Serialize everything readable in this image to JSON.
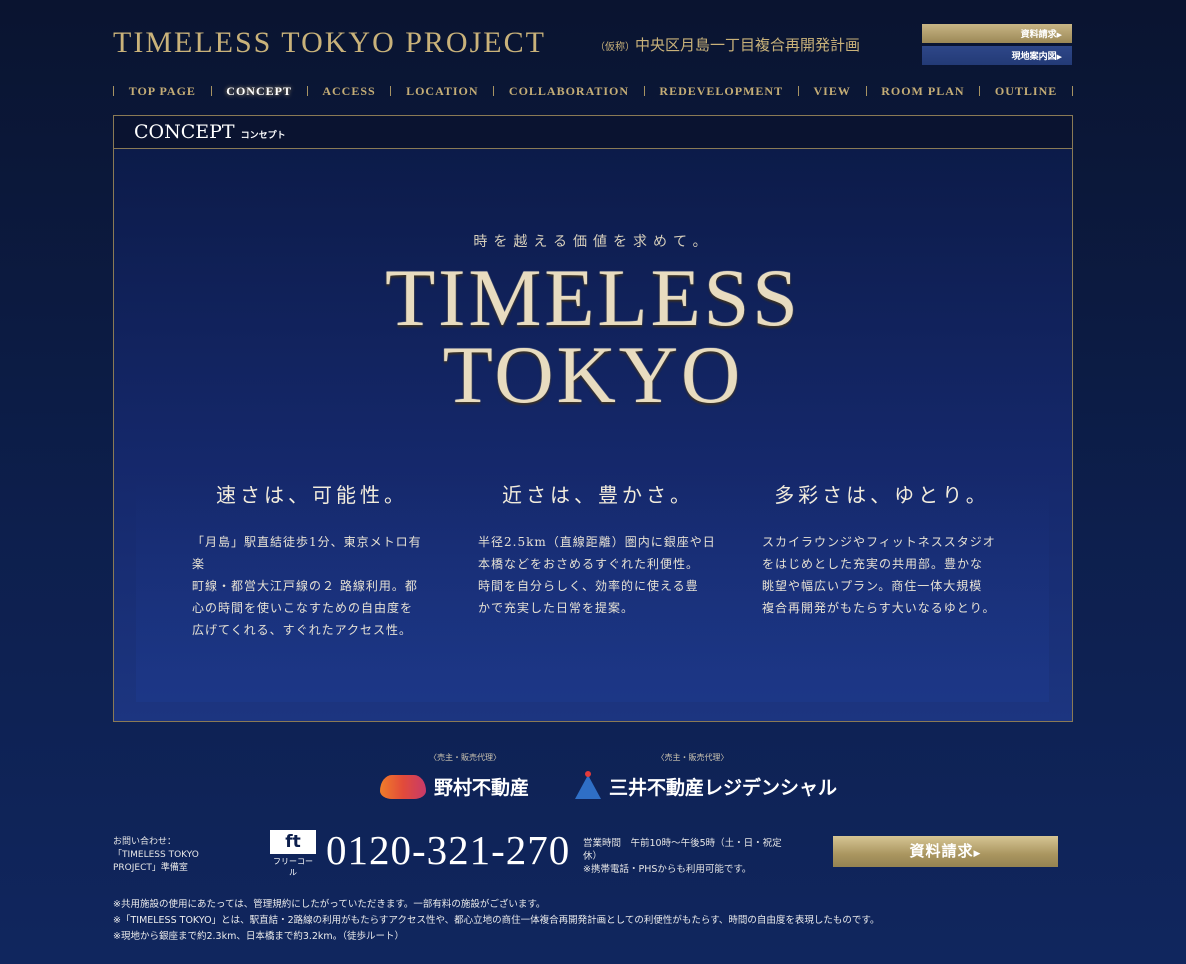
{
  "header": {
    "logo": "TIMELESS TOKYO PROJECT",
    "subtitle_prefix": "（仮称）",
    "subtitle": "中央区月島一丁目複合再開発計画",
    "buttons": [
      {
        "label": "資料請求",
        "arrow": "▶"
      },
      {
        "label": "現地案内図",
        "arrow": "▶"
      }
    ],
    "colors": {
      "gold": "#c9b27a",
      "navy_button": "#2e4788"
    }
  },
  "nav": {
    "items": [
      {
        "label": "TOP PAGE"
      },
      {
        "label": "CONCEPT",
        "active": true
      },
      {
        "label": "ACCESS"
      },
      {
        "label": "LOCATION"
      },
      {
        "label": "COLLABORATION"
      },
      {
        "label": "REDEVELOPMENT"
      },
      {
        "label": "VIEW"
      },
      {
        "label": "ROOM PLAN"
      },
      {
        "label": "OUTLINE"
      }
    ]
  },
  "panel": {
    "title": "CONCEPT",
    "title_sub": "コンセプト"
  },
  "hero": {
    "tagline": "時を越える価値を求めて。",
    "title_line1": "TIMELESS",
    "title_line2": "TOKYO",
    "columns": [
      {
        "heading": "速さは、可能性。",
        "lines": [
          "「月島」駅直結徒歩1分、東京メトロ有楽",
          "町線・都営大江戸線の２ 路線利用。都",
          "心の時間を使いこなすための自由度を",
          "広げてくれる、すぐれたアクセス性。"
        ]
      },
      {
        "heading": "近さは、豊かさ。",
        "lines": [
          "半径2.5km（直線距離）圏内に銀座や日",
          "本橋などをおさめるすぐれた利便性。",
          "時間を自分らしく、効率的に使える豊",
          "かで充実した日常を提案。"
        ]
      },
      {
        "heading": "多彩さは、ゆとり。",
        "lines": [
          "スカイラウンジやフィットネススタジオ",
          "をはじめとした充実の共用部。豊かな",
          "眺望や幅広いプラン。商住一体大規模",
          "複合再開発がもたらす大いなるゆとり。"
        ]
      }
    ]
  },
  "partners": [
    {
      "role": "〈売主・販売代理〉",
      "name": "野村不動産",
      "icon": "nomura-logo-icon"
    },
    {
      "role": "〈売主・販売代理〉",
      "name": "三井不動産レジデンシャル",
      "icon": "mitsui-logo-icon"
    }
  ],
  "contact": {
    "label_lines": [
      "お問い合わせ：",
      "「TIMELESS TOKYO",
      "PROJECT」準備室"
    ],
    "freecall_mark": "ft",
    "freecall_text": "フリーコール",
    "phone": "0120-321-270",
    "hours_lines": [
      "営業時間　午前10時〜午後5時（土・日・祝定",
      "休）",
      "※携帯電話・PHSからも利用可能です。"
    ],
    "request_button": "資料請求",
    "request_arrow": "▶"
  },
  "notes": [
    "※共用施設の使用にあたっては、管理規約にしたがっていただきます。一部有料の施設がございます。",
    "※「TIMELESS TOKYO」とは、駅直結・2路線の利用がもたらすアクセス性や、都心立地の商住一体複合再開発計画としての利便性がもたらす、時間の自由度を表現したものです。",
    "※現地から銀座まで約2.3km、日本橋まで約3.2km。（徒歩ルート）"
  ]
}
